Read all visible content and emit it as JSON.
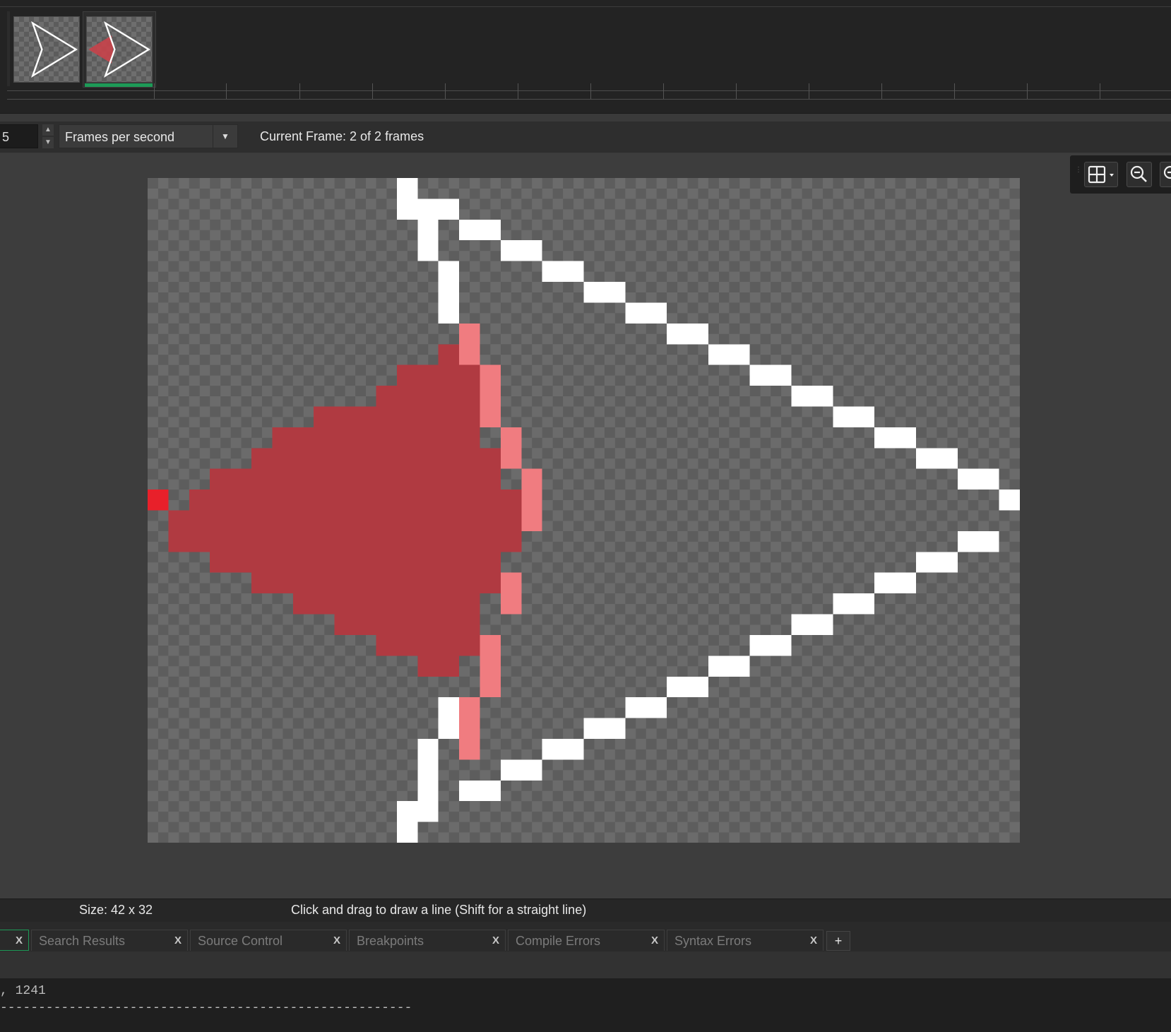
{
  "frames": {
    "items": [
      {
        "label": "frame 1",
        "active": false
      },
      {
        "label": "frame 2",
        "active": true
      }
    ]
  },
  "animation": {
    "fps_value": "5",
    "speed_mode": "Frames per second",
    "current_frame_text": "Current Frame: 2 of 2 frames"
  },
  "view_toolbar": {
    "grid_icon": "grid-icon",
    "zoom_out_icon": "zoom-out-icon",
    "zoom_extra_icon": "zoom-icon"
  },
  "status": {
    "size": "Size: 42 x 32",
    "hint": "Click and drag to draw a line (Shift for a straight line)"
  },
  "bottom_tabs": [
    {
      "label": ""
    },
    {
      "label": "Search Results"
    },
    {
      "label": "Source Control"
    },
    {
      "label": "Breakpoints"
    },
    {
      "label": "Compile Errors"
    },
    {
      "label": "Syntax Errors"
    }
  ],
  "tab_close_label": "X",
  "tab_add_label": "+",
  "output": {
    "line1": ", 1241",
    "line2": "------------------------------------------------------"
  },
  "colors": {
    "accent": "#1d9a57",
    "outline": "#ffffff",
    "fill": "#b03a41",
    "edge_light": "#f07c80",
    "tip": "#e8202a"
  }
}
